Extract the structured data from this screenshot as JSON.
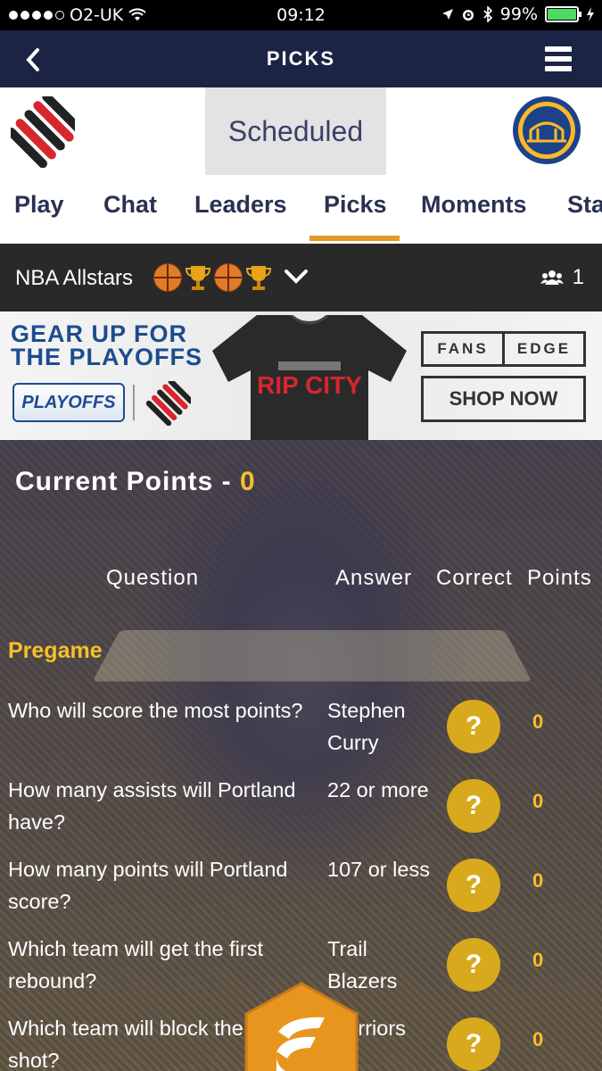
{
  "status_bar": {
    "carrier": "O2-UK",
    "time": "09:12",
    "battery": "99%",
    "battery_level": 0.99
  },
  "navbar": {
    "title": "PICKS"
  },
  "game": {
    "status": "Scheduled",
    "tabs": [
      "Play",
      "Chat",
      "Leaders",
      "Picks",
      "Moments",
      "Sta"
    ],
    "active_tab": "Picks",
    "accent_color": "#e39a25"
  },
  "league": {
    "name": "NBA Allstars",
    "member_count": "1"
  },
  "ad": {
    "headline_line1": "GEAR UP FOR",
    "headline_line2": "THE PLAYOFFS",
    "playoffs_logo": "PLAYOFFS",
    "shirt_text": "RIP CITY",
    "brand_left": "FANS",
    "brand_right": "EDGE",
    "cta": "SHOP NOW"
  },
  "picks": {
    "current_points_label": "Current Points - ",
    "current_points_value": "0",
    "columns": {
      "question": "Question",
      "answer": "Answer",
      "correct": "Correct",
      "points": "Points"
    },
    "section": "Pregame",
    "rows": [
      {
        "question": "Who will score the most points?",
        "answer": "Stephen Curry",
        "correct": "?",
        "points": "0"
      },
      {
        "question": "How many assists will Portland have?",
        "answer": "22 or more",
        "correct": "?",
        "points": "0"
      },
      {
        "question": "How many points will Portland score?",
        "answer": "107 or less",
        "correct": "?",
        "points": "0"
      },
      {
        "question": "Which team will get the first rebound?",
        "answer": "Trail Blazers",
        "correct": "?",
        "points": "0"
      },
      {
        "question": "Which team will block the first shot?",
        "answer": "Warriors",
        "correct": "?",
        "points": "0"
      }
    ]
  },
  "colors": {
    "navbar": "#1b2444",
    "highlight": "#f5c02a",
    "correct_circle": "#d8a91c"
  }
}
